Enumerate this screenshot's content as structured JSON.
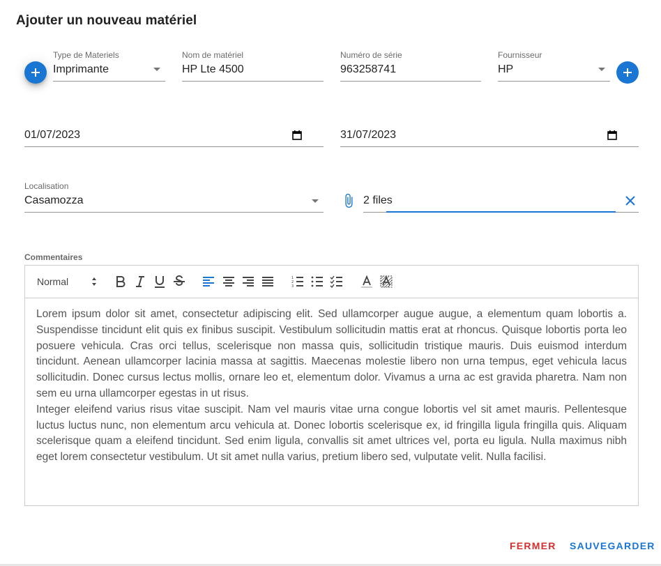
{
  "dialog": {
    "title": "Ajouter un nouveau matériel"
  },
  "form": {
    "type_materiel": {
      "label": "Type de Materiels",
      "value": "Imprimante"
    },
    "nom_materiel": {
      "label": "Nom de matériel",
      "value": "HP Lte 4500"
    },
    "numero_serie": {
      "label": "Numéro de série",
      "value": "963258741"
    },
    "fournisseur": {
      "label": "Fournisseur",
      "value": "HP"
    },
    "date_debut": {
      "value": "01/07/2023"
    },
    "date_fin": {
      "value": "31/07/2023"
    },
    "localisation": {
      "label": "Localisation",
      "value": "Casamozza"
    },
    "fichiers": {
      "value": "2 files"
    }
  },
  "commentaires": {
    "label": "Commentaires",
    "toolbar": {
      "header_value": "Normal"
    },
    "paragraphs": [
      "Lorem ipsum dolor sit amet, consectetur adipiscing elit. Sed ullamcorper augue augue, a elementum quam lobortis a. Suspendisse tincidunt elit quis ex finibus suscipit. Vestibulum sollicitudin mattis erat at rhoncus. Quisque lobortis porta leo posuere vehicula. Cras orci tellus, scelerisque non massa quis, sollicitudin tristique mauris. Duis euismod interdum tincidunt. Aenean ullamcorper lacinia massa at sagittis. Maecenas molestie libero non urna tempus, eget vehicula lacus sollicitudin. Donec cursus lectus mollis, ornare leo et, elementum dolor. Vivamus a urna ac est gravida pharetra. Nam non sem eu urna ullamcorper egestas in ut risus.",
      "Integer eleifend varius risus vitae suscipit. Nam vel mauris vitae urna congue lobortis vel sit amet mauris. Pellentesque luctus luctus nunc, non elementum arcu vehicula at. Donec lobortis scelerisque ex, id fringilla ligula fringilla quis. Aliquam scelerisque quam a eleifend tincidunt. Sed enim ligula, convallis sit amet ultrices vel, porta eu ligula. Nulla maximus nibh eget lorem consectetur vestibulum. Ut sit amet nulla varius, pretium libero sed, vulputate velit. Nulla facilisi."
    ]
  },
  "actions": {
    "close_label": "FERMER",
    "save_label": "SAUVEGARDER"
  },
  "colors": {
    "primary": "#1976d2",
    "error": "#d32f2f"
  }
}
